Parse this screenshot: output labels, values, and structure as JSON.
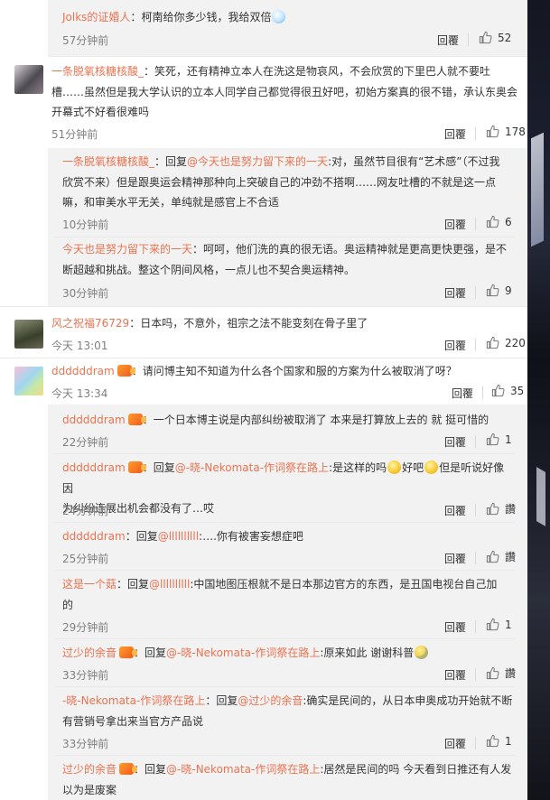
{
  "labels": {
    "reply": "回覆",
    "like_icon": "thumbs-up-icon"
  },
  "colors": {
    "username": "#eb7350",
    "time": "#808080",
    "text": "#333333",
    "reply_bg": "#f2f2f2"
  },
  "comments": [
    {
      "user": "Jolks的证婚人",
      "sep": "：",
      "text": "柯南给你多少钱，我给双倍",
      "time": "57分钟前",
      "likes": "52"
    },
    {
      "user": "一条脱氧核糖核酸_",
      "sep": "：",
      "text1": "笑死，还有精神立本人在洗这是物哀风，不会欣赏的下里巴人就不要吐",
      "text2": "槽……虽然但是我大学认识的立本人同学自己都觉得很丑好吧，初始方案真的很不错，承认东奥会",
      "text3": "开幕式不好看很难吗",
      "time": "51分钟前",
      "likes": "178"
    },
    {
      "user": "一条脱氧核糖核酸_",
      "sep": "：回复",
      "mention": "@今天也是努力留下来的一天",
      "text1": ":对，虽然节目很有“艺术感”（不过我",
      "text2": "欣赏不来）但是跟奥运会精神那种向上突破自己的冲劲不搭啊……网友吐槽的不就是这一点",
      "text3": "嘛，和审美水平无关，单纯就是感官上不合适",
      "time": "10分钟前",
      "likes": "6"
    },
    {
      "user": "今天也是努力留下来的一天",
      "sep": "：",
      "text1": "呵呵，他们洗的真的很无语。奥运精神就是更高更快更强，是不",
      "text2": "断超越和挑战。整这个阴间风格，一点儿也不契合奥运精神。",
      "time": "30分钟前",
      "likes": "9"
    },
    {
      "user": "风之祝福76729",
      "sep": "：",
      "text": "日本吗，不意外，祖宗之法不能变刻在骨子里了",
      "time": "今天 13:01",
      "likes": "220"
    },
    {
      "user": "ddddddram",
      "sep": "：",
      "text": "请问博主知不知道为什么各个国家和服的方案为什么被取消了呀？",
      "time": "今天 13:34",
      "likes": "35"
    },
    {
      "user": "ddddddram",
      "sep": "：",
      "text": "一个日本博主说是内部纠纷被取消了 本来是打算放上去的 就 挺可惜的",
      "time": "22分钟前",
      "likes": "1"
    },
    {
      "user": "ddddddram",
      "sep": "：回复",
      "mention": "@-晓-Nekomata-作词祭在路上",
      "text1": ":是这样的吗",
      "text1b": "好吧",
      "text1c": "但是听说好像因",
      "text2": "为纠纷连展出机会都没有了…哎",
      "time": "24分钟前",
      "likes": "讚"
    },
    {
      "user": "ddddddram",
      "sep": "：回复",
      "mention": "@llllllllll",
      "text": ":….你有被害妄想症吧",
      "time": "25分钟前",
      "likes": "讚"
    },
    {
      "user": "这是一个菇",
      "sep": "：回复",
      "mention": "@llllllllll",
      "text1": ":中国地图压根就不是日本那边官方的东西，是丑国电视台自己加",
      "text2": "的",
      "time": "29分钟前",
      "likes": "1"
    },
    {
      "user": "过少的余音",
      "sep": "：回复",
      "mention": "@-晓-Nekomata-作词祭在路上",
      "text": ":原来如此 谢谢科普",
      "time": "33分钟前",
      "likes": "讚"
    },
    {
      "user": "-晓-Nekomata-作词祭在路上",
      "sep": "：回复",
      "mention": "@过少的余音",
      "text1": ":确实是民间的，从日本申奥成功开始就不断",
      "text2": "有营销号拿出来当官方产品说",
      "time": "33分钟前",
      "likes": "1"
    },
    {
      "user": "过少的余音",
      "sep": "：回复",
      "mention": "@-晓-Nekomata-作词祭在路上",
      "text1": ":居然是民间的吗 今天看到日推还有人发",
      "text2": "以为是废案"
    }
  ]
}
